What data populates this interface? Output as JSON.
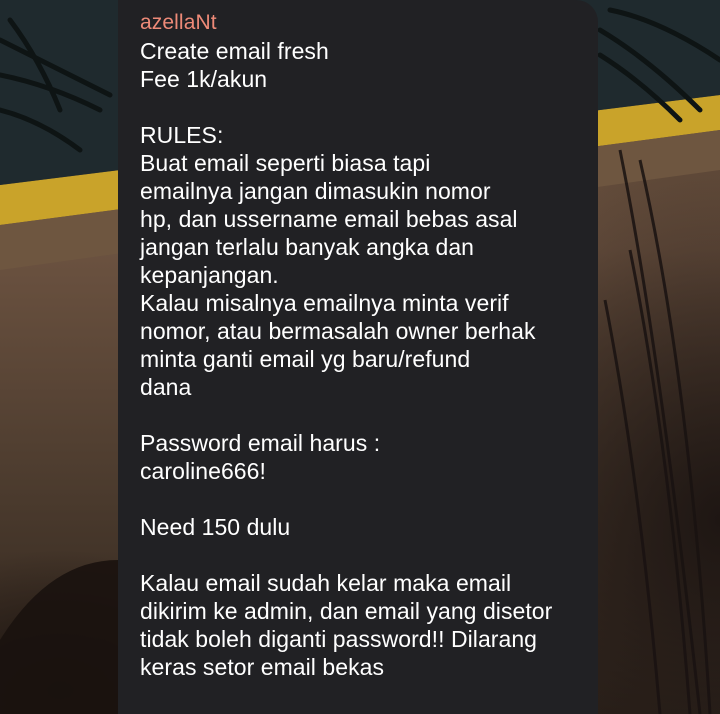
{
  "chat": {
    "sender_name": "azellaNt",
    "message_text": "Create email fresh\nFee 1k/akun\n\nRULES:\nBuat email seperti biasa tapi\nemailnya jangan dimasukin nomor\nhp, dan ussername email bebas asal\njangan terlalu banyak angka dan\nkepanjangan.\nKalau misalnya emailnya minta verif\nnomor, atau bermasalah owner berhak\nminta ganti email yg baru/refund\ndana\n\nPassword email harus :\ncaroline666!\n\nNeed 150 dulu\n\nKalau email sudah kelar maka email\ndikirim ke admin, dan email yang disetor\ntidak boleh diganti password!! Dilarang\nkeras setor email bekas"
  },
  "colors": {
    "bubble_background": "#212124",
    "sender_name": "#ee8a78",
    "message_text": "#ffffff"
  }
}
